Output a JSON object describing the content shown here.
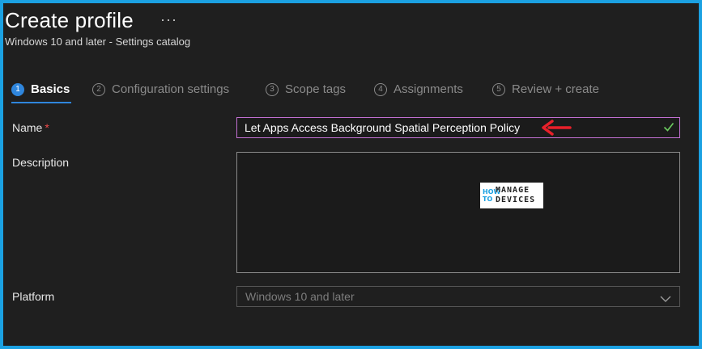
{
  "header": {
    "title": "Create profile",
    "more_label": "···",
    "subtitle": "Windows 10 and later - Settings catalog"
  },
  "tabs": [
    {
      "number": "1",
      "label": "Basics",
      "active": true
    },
    {
      "number": "2",
      "label": "Configuration settings",
      "active": false
    },
    {
      "number": "3",
      "label": "Scope tags",
      "active": false
    },
    {
      "number": "4",
      "label": "Assignments",
      "active": false
    },
    {
      "number": "5",
      "label": "Review + create",
      "active": false
    }
  ],
  "form": {
    "name_label": "Name",
    "required_marker": "*",
    "name_value": "Let Apps Access Background Spatial Perception Policy",
    "description_label": "Description",
    "description_value": "",
    "platform_label": "Platform",
    "platform_value": "Windows 10 and later"
  },
  "watermark": {
    "line1": "HOW",
    "line2": "TO",
    "line3": "MANAGE",
    "line4": "DEVICES"
  },
  "colors": {
    "accent": "#2f86dd",
    "name_border": "#c270d2",
    "required": "#f04a4a",
    "valid_check": "#6ccb5f",
    "annotation_arrow": "#e8202a",
    "frame_border": "#1ba1e2"
  }
}
